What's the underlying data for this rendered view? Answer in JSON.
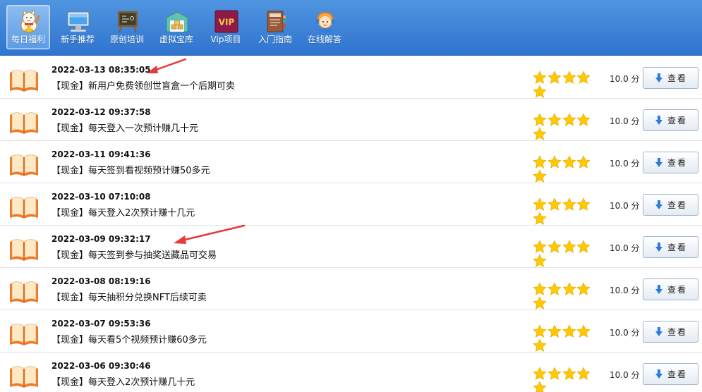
{
  "toolbar": {
    "tabs": [
      {
        "label": "每日福利",
        "icon": "lucky-cat-icon",
        "active": true
      },
      {
        "label": "新手推荐",
        "icon": "computer-monitor-icon",
        "active": false
      },
      {
        "label": "原创培训",
        "icon": "blackboard-icon",
        "active": false
      },
      {
        "label": "虚拟宝库",
        "icon": "warehouse-icon",
        "active": false
      },
      {
        "label": "Vip项目",
        "icon": "vip-badge-icon",
        "badge_text": "VIP",
        "active": false
      },
      {
        "label": "入门指南",
        "icon": "guide-book-icon",
        "active": false
      },
      {
        "label": "在线解答",
        "icon": "support-agent-icon",
        "active": false
      }
    ]
  },
  "list": {
    "items": [
      {
        "date": "2022-03-13 08:35:05",
        "title": "【现金】新用户免费领创世盲盒一个后期可卖",
        "rating": 5,
        "score": "10.0 分",
        "button": "查看"
      },
      {
        "date": "2022-03-12 09:37:58",
        "title": "【现金】每天登入一次预计赚几十元",
        "rating": 5,
        "score": "10.0 分",
        "button": "查看"
      },
      {
        "date": "2022-03-11 09:41:36",
        "title": "【现金】每天签到看视频预计赚50多元",
        "rating": 5,
        "score": "10.0 分",
        "button": "查看"
      },
      {
        "date": "2022-03-10 07:10:08",
        "title": "【现金】每天登入2次预计赚十几元",
        "rating": 5,
        "score": "10.0 分",
        "button": "查看"
      },
      {
        "date": "2022-03-09 09:32:17",
        "title": "【现金】每天签到参与抽奖送藏品可交易",
        "rating": 5,
        "score": "10.0 分",
        "button": "查看"
      },
      {
        "date": "2022-03-08 08:19:16",
        "title": "【现金】每天抽积分兑换NFT后续可卖",
        "rating": 5,
        "score": "10.0 分",
        "button": "查看"
      },
      {
        "date": "2022-03-07 09:53:36",
        "title": "【现金】每天看5个视频预计赚60多元",
        "rating": 5,
        "score": "10.0 分",
        "button": "查看"
      },
      {
        "date": "2022-03-06 09:30:46",
        "title": "【现金】每天登入2次预计赚几十元",
        "rating": 5,
        "score": "10.0 分",
        "button": "查看"
      }
    ]
  },
  "colors": {
    "toolbar_top": "#4f95e0",
    "toolbar_bottom": "#2f74cf",
    "star": "#ffc800",
    "annotation_arrow": "#e8383a",
    "book_orange": "#f0782a"
  }
}
